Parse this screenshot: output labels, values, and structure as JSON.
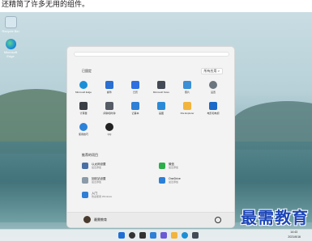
{
  "caption": "还精简了许多无用的组件。",
  "desktop": {
    "icons": [
      {
        "label": "Recycle Bin",
        "color": "#d7e7f0"
      },
      {
        "label": "Microsoft Edge",
        "color": "#1a8fd7"
      }
    ]
  },
  "start_menu": {
    "pinned_title": "已固定",
    "all_apps_label": "所有应用 >",
    "pinned": [
      {
        "label": "Microsoft Edge",
        "icon": "edge-icon",
        "color": "#1a8fd7"
      },
      {
        "label": "邮件",
        "icon": "mail-icon",
        "color": "#2b6fd1"
      },
      {
        "label": "日历",
        "icon": "calendar-icon",
        "color": "#2f6fe0"
      },
      {
        "label": "Microsoft Store",
        "icon": "store-icon",
        "color": "#444a55"
      },
      {
        "label": "照片",
        "icon": "photos-icon",
        "color": "#3a8fd5"
      },
      {
        "label": "设置",
        "icon": "settings-icon",
        "color": "#6b7580"
      },
      {
        "label": "计算器",
        "icon": "calculator-icon",
        "color": "#3a3f46"
      },
      {
        "label": "闹钟和时钟",
        "icon": "clock-icon",
        "color": "#555c66"
      },
      {
        "label": "记事本",
        "icon": "notepad-icon",
        "color": "#2f7fd6"
      },
      {
        "label": "画图",
        "icon": "paint-icon",
        "color": "#2b8ad8"
      },
      {
        "label": "File Explorer",
        "icon": "folder-icon",
        "color": "#f2b43c"
      },
      {
        "label": "电影和电视",
        "icon": "video-icon",
        "color": "#1a68c9"
      },
      {
        "label": "使用技巧",
        "icon": "tips-icon",
        "color": "#2d82d9"
      },
      {
        "label": "QQ",
        "icon": "qq-icon",
        "color": "#222222"
      }
    ],
    "recommended_title": "推荐的项目",
    "recommended": [
      {
        "name": "以太网设置",
        "sub": "最近添加",
        "icon": "network-icon",
        "color": "#4a6fa5"
      },
      {
        "name": "微信",
        "sub": "最近添加",
        "icon": "wechat-icon",
        "color": "#2bae4a"
      },
      {
        "name": "回收站设置",
        "sub": "最近添加",
        "icon": "recycle-bin-icon",
        "color": "#8a9aa8"
      },
      {
        "name": "OneDrive",
        "sub": "最近添加",
        "icon": "onedrive-icon",
        "color": "#2c7fd8"
      },
      {
        "name": "入门",
        "sub": "欢迎使用 Windows",
        "icon": "get-started-icon",
        "color": "#2f7fd6"
      }
    ],
    "user_name": "最需教育"
  },
  "taskbar": {
    "time": "14:43",
    "date": "2021/6/16",
    "items": [
      {
        "icon": "start-icon",
        "color": "#1f6fd6"
      },
      {
        "icon": "search-icon",
        "color": "#333333"
      },
      {
        "icon": "task-view-icon",
        "color": "#333333"
      },
      {
        "icon": "widgets-icon",
        "color": "#2f7fd6"
      },
      {
        "icon": "chat-icon",
        "color": "#6a5ad6"
      },
      {
        "icon": "folder-icon",
        "color": "#f2b43c"
      },
      {
        "icon": "edge-icon",
        "color": "#1a8fd7"
      },
      {
        "icon": "store-icon",
        "color": "#444a55"
      }
    ]
  },
  "watermark": "最需教育"
}
